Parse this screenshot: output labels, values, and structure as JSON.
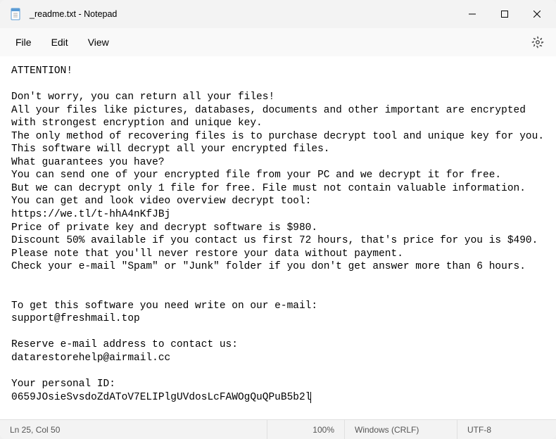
{
  "window": {
    "title": "_readme.txt - Notepad"
  },
  "menu": {
    "file": "File",
    "edit": "Edit",
    "view": "View"
  },
  "content": {
    "text": "ATTENTION!\n\nDon't worry, you can return all your files!\nAll your files like pictures, databases, documents and other important are encrypted with strongest encryption and unique key.\nThe only method of recovering files is to purchase decrypt tool and unique key for you.\nThis software will decrypt all your encrypted files.\nWhat guarantees you have?\nYou can send one of your encrypted file from your PC and we decrypt it for free.\nBut we can decrypt only 1 file for free. File must not contain valuable information.\nYou can get and look video overview decrypt tool:\nhttps://we.tl/t-hhA4nKfJBj\nPrice of private key and decrypt software is $980.\nDiscount 50% available if you contact us first 72 hours, that's price for you is $490.\nPlease note that you'll never restore your data without payment.\nCheck your e-mail \"Spam\" or \"Junk\" folder if you don't get answer more than 6 hours.\n\n\nTo get this software you need write on our e-mail:\nsupport@freshmail.top\n\nReserve e-mail address to contact us:\ndatarestorehelp@airmail.cc\n\nYour personal ID:\n0659JOsieSvsdoZdAToV7ELIPlgUVdosLcFAWOgQuQPuB5b2l"
  },
  "status": {
    "cursor": "Ln 25, Col 50",
    "zoom": "100%",
    "line_ending": "Windows (CRLF)",
    "encoding": "UTF-8"
  }
}
